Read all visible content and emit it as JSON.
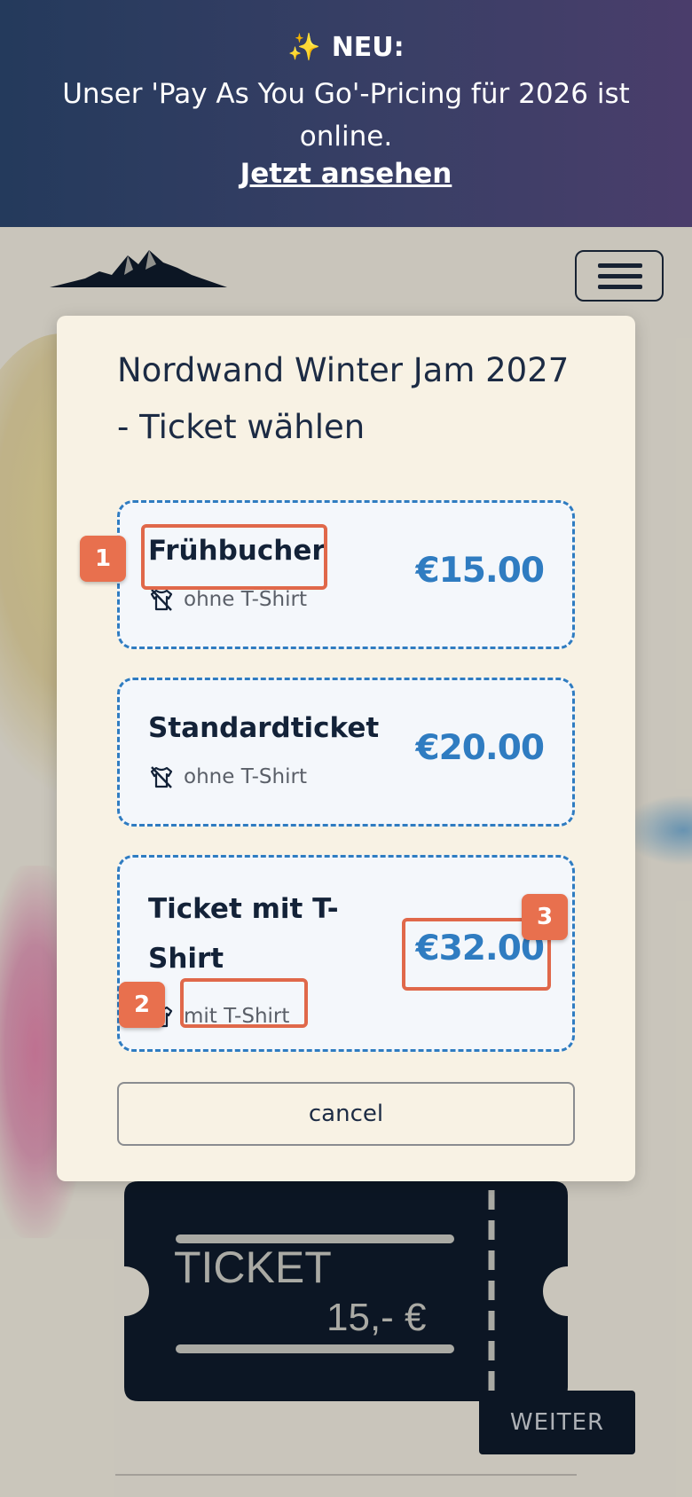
{
  "banner": {
    "sparkle": "✨",
    "label": "NEU:",
    "message": "Unser 'Pay As You Go'-Pricing für 2026 ist online.",
    "link": "Jetzt ansehen"
  },
  "page": {
    "ticket_art_word": "TICKET",
    "ticket_art_price": "15,- €",
    "next_button": "WEITER"
  },
  "modal": {
    "title": "Nordwand Winter Jam 2027 - Ticket wählen",
    "options": [
      {
        "name": "Frühbucher",
        "tshirt_icon": "no-shirt-icon",
        "subtitle": "ohne T-Shirt",
        "price": "€15.00"
      },
      {
        "name": "Standardticket",
        "tshirt_icon": "no-shirt-icon",
        "subtitle": "ohne T-Shirt",
        "price": "€20.00"
      },
      {
        "name": "Ticket mit T-Shirt",
        "tshirt_icon": "shirt-icon",
        "subtitle": "mit T-Shirt",
        "price": "€32.00"
      }
    ],
    "cancel_label": "cancel"
  },
  "annotations": [
    "1",
    "2",
    "3"
  ],
  "colors": {
    "accent": "#2f7cc1",
    "marker": "#e8704e",
    "banner_start": "#243a5c",
    "banner_end": "#4a3d6b",
    "navy": "#0f1b2d"
  }
}
